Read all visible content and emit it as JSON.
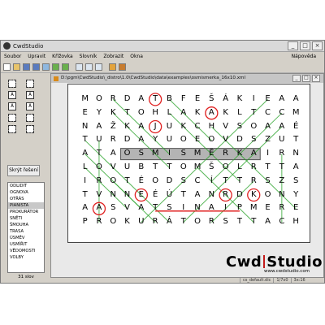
{
  "app": {
    "title": "CwdStudio"
  },
  "menu": [
    "Soubor",
    "Upravit",
    "Křížovka",
    "Slovník",
    "Zobrazit",
    "Okna"
  ],
  "menu_help": "Nápověda",
  "sidebar": {
    "hint_button": "Skrýt řešení",
    "words": [
      "ODLIDIT",
      "OGNOVA",
      "OTŘÁS",
      "PIANISTA",
      "PROKURÁTOR",
      "SNĚTI",
      "ŠMOUHA",
      "TRASA",
      "ÚSMĚV",
      "USMÍŘIT",
      "VĚDOMOSTI",
      "VOLBY"
    ],
    "selected_index": 3,
    "count": "31 slov"
  },
  "document": {
    "path": "D:\\pgm\\CwdStudio\\_distro\\1.0\\CwdStudio\\data\\examples\\osmismerka_16x10.xml"
  },
  "grid": {
    "rows": [
      [
        "M",
        "O",
        "R",
        "D",
        "A",
        "T",
        "B",
        "F",
        "E",
        "Š",
        "Á",
        "K",
        "I",
        "E",
        "A",
        "A"
      ],
      [
        "E",
        "Y",
        "K",
        "T",
        "O",
        "H",
        "L",
        "A",
        "K",
        "A",
        "K",
        "L",
        "T",
        "C",
        "C",
        "M"
      ],
      [
        "N",
        "A",
        "Ž",
        "K",
        "A",
        "J",
        "U",
        "K",
        "C",
        "H",
        "V",
        "S",
        "O",
        "A",
        "A",
        "É"
      ],
      [
        "T",
        "U",
        "R",
        "D",
        "A",
        "Y",
        "U",
        "O",
        "E",
        "O",
        "V",
        "D",
        "S",
        "Z",
        "U",
        "T"
      ],
      [
        "A",
        "T",
        "A",
        "O",
        "S",
        "M",
        "I",
        "S",
        "M",
        "Ě",
        "R",
        "K",
        "A",
        "I",
        "R",
        "N"
      ],
      [
        "L",
        "O",
        "V",
        "U",
        "B",
        "T",
        "T",
        "O",
        "M",
        "Š",
        "O",
        "L",
        "R",
        "T",
        "T",
        "A"
      ],
      [
        "I",
        "R",
        "O",
        "T",
        "É",
        "O",
        "D",
        "S",
        "C",
        "Í",
        "T",
        "T",
        "R",
        "S",
        "Z",
        "S"
      ],
      [
        "T",
        "V",
        "N",
        "N",
        "E",
        "É",
        "Ú",
        "T",
        "A",
        "N",
        "R",
        "D",
        "K",
        "O",
        "N",
        "Y"
      ],
      [
        "A",
        "A",
        "S",
        "V",
        "A",
        "T",
        "S",
        "I",
        "N",
        "A",
        "I",
        "P",
        "M",
        "E",
        "R",
        "E"
      ],
      [
        "P",
        "R",
        "O",
        "K",
        "U",
        "R",
        "Á",
        "T",
        "O",
        "R",
        "S",
        "T",
        "T",
        "A",
        "C",
        "H"
      ]
    ],
    "circled": [
      [
        0,
        5
      ],
      [
        1,
        9
      ],
      [
        2,
        5
      ],
      [
        7,
        4
      ],
      [
        7,
        10
      ],
      [
        7,
        12
      ],
      [
        8,
        1
      ]
    ]
  },
  "status": {
    "file": "cs_default.dic",
    "position": "1/7x0",
    "zoom": "3x:16"
  },
  "logo": {
    "brand_left": "Cwd",
    "brand_right": "Studio",
    "url": "www.cwdstudio.com"
  },
  "colors": {
    "circle": "#e02020",
    "line": "#2ea52e",
    "highlight": "#8c8c8c",
    "underline": "#e02020"
  }
}
